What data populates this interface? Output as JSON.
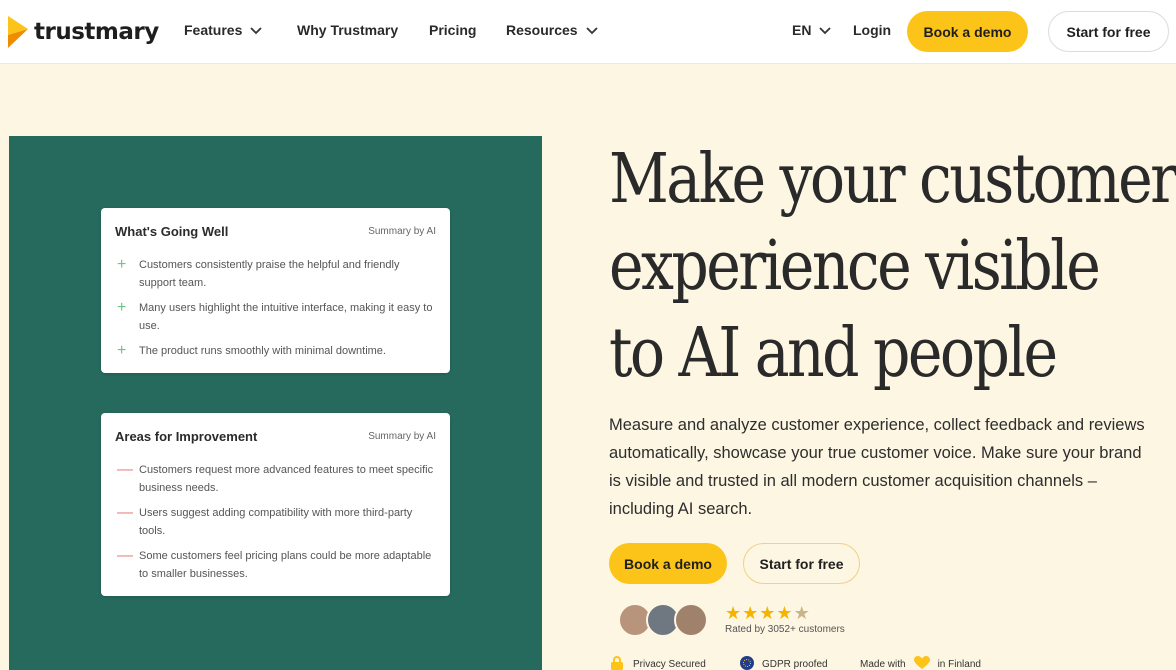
{
  "brand": {
    "name": "trustmary",
    "accent": "#fcc419",
    "panel_green": "#266a5e",
    "background": "#fdf6e3"
  },
  "nav": {
    "features": "Features",
    "why": "Why Trustmary",
    "pricing": "Pricing",
    "resources": "Resources",
    "language": "EN",
    "login": "Login",
    "book_demo": "Book a demo",
    "start_free": "Start for free"
  },
  "cards": {
    "well": {
      "title": "What's Going Well",
      "tag": "Summary by AI",
      "items": [
        "Customers consistently praise the helpful and friendly support team.",
        "Many users highlight the intuitive interface, making it easy to use.",
        "The product runs smoothly with minimal downtime."
      ]
    },
    "improve": {
      "title": "Areas for Improvement",
      "tag": "Summary by AI",
      "items": [
        "Customers request more advanced features to meet specific business needs.",
        "Users suggest adding compatibility with more third-party tools.",
        "Some customers feel pricing plans could be more adaptable to smaller businesses."
      ]
    }
  },
  "hero": {
    "title_line1": "Make your customer",
    "title_line2": "experience visible",
    "title_line3": "to AI and people",
    "description": "Measure and analyze customer experience, collect feedback and reviews automatically, showcase your true customer voice. Make sure your brand is visible and trusted in all modern customer acquisition channels – including AI search.",
    "book_demo": "Book a demo",
    "start_free": "Start for free"
  },
  "rating": {
    "stars": 4.5,
    "text": "Rated by 3052+ customers"
  },
  "trust": {
    "privacy": "Privacy Secured",
    "gdpr": "GDPR proofed",
    "made_with": "Made with",
    "in_finland": "in Finland"
  },
  "icons": [
    "logo-icon",
    "chevron-down-icon",
    "plus-icon",
    "minus-icon",
    "star-icon",
    "lock-icon",
    "eu-flag-icon",
    "heart-icon"
  ]
}
